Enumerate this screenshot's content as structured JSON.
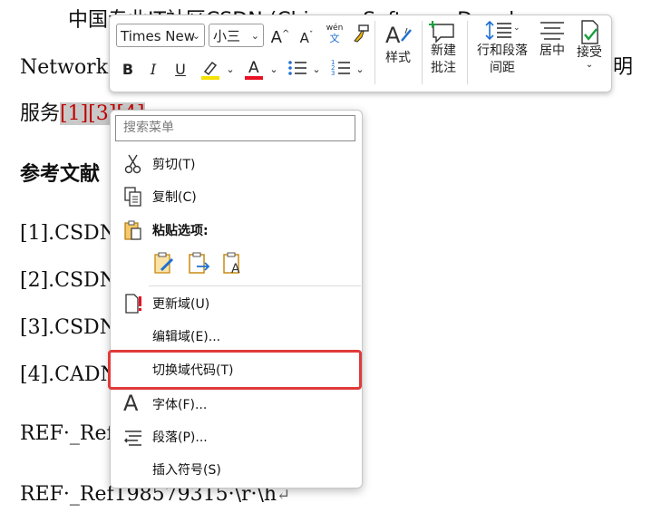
{
  "document": {
    "line1_prefix": "中国专业IT社区CSDN (Chinese Software Develop",
    "line2": "Network)",
    "line2_tail": "明",
    "line3_prefix": "服务",
    "line3_refs": "[1][3][4]",
    "heading_refs": "参考文献",
    "ref1": "[1].CSDN",
    "ref2": "[2].CSDN",
    "ref3": "[3].CSDN",
    "ref4": "[4].CADN",
    "field1": "REF·_Ref",
    "field2": "REF·_Ref198579315·\\r·\\h",
    "para_mark": "↵"
  },
  "toolbar": {
    "font_name": "Times New",
    "font_size": "小三",
    "grow_font": "A^",
    "shrink_font": "Aˇ",
    "phonetic_top": "wén",
    "phonetic_bottom": "文",
    "bold": "B",
    "italic": "I",
    "underline": "U",
    "font_color_letter": "A",
    "styles_label": "样式",
    "new_comment_label1": "新建",
    "new_comment_label2": "批注",
    "spacing_label1": "行和段落",
    "spacing_label2": "间距",
    "center_label": "居中",
    "accept_label": "接受",
    "highlight_color": "#f5e100",
    "font_color": "#e81123"
  },
  "context_menu": {
    "search_placeholder": "搜索菜单",
    "cut": "剪切(T)",
    "copy": "复制(C)",
    "paste_options": "粘贴选项:",
    "update_field": "更新域(U)",
    "edit_field": "编辑域(E)...",
    "toggle_field_codes": "切换域代码(T)",
    "font": "字体(F)...",
    "paragraph": "段落(P)...",
    "insert_symbol": "插入符号(S)"
  },
  "colors": {
    "highlight_border": "#e03a3a",
    "ref_red": "#c00000"
  }
}
